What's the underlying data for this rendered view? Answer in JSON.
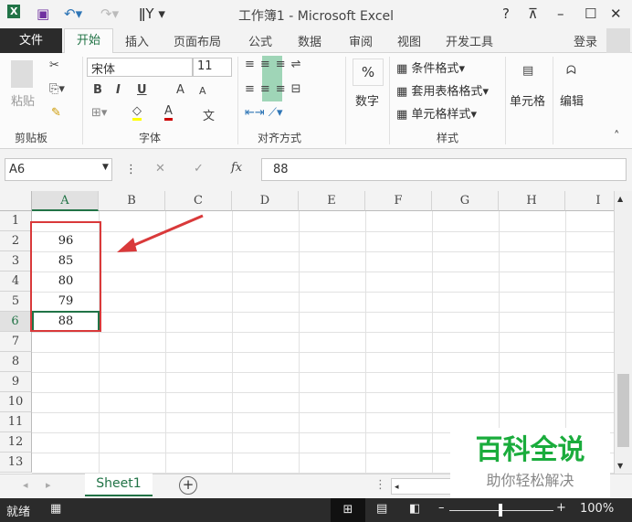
{
  "title": "工作簿1 - Microsoft Excel",
  "window_buttons": {
    "help": "?",
    "restore_ribbon": "⊼",
    "minimize": "–",
    "maximize": "☐",
    "close": "✕"
  },
  "tabs": {
    "file": "文件",
    "home": "开始",
    "insert": "插入",
    "layout": "页面布局",
    "formulas": "公式",
    "data": "数据",
    "review": "审阅",
    "view": "视图",
    "developer": "开发工具",
    "signin": "登录"
  },
  "ribbon": {
    "clipboard": {
      "paste": "粘贴",
      "label": "剪贴板"
    },
    "font": {
      "name": "宋体",
      "size": "11",
      "bold": "B",
      "italic": "I",
      "underline": "U",
      "grow": "A",
      "shrink": "A",
      "color": "A",
      "phonetic": "文",
      "label": "字体"
    },
    "alignment": {
      "label": "对齐方式"
    },
    "number": {
      "percent": "%",
      "label": "数字"
    },
    "styles": {
      "conditional": "条件格式",
      "table": "套用表格格式",
      "cell": "单元格样式",
      "label": "样式"
    },
    "cells": {
      "label": "单元格"
    },
    "editing": {
      "label": "编辑"
    }
  },
  "formula_bar": {
    "name_box": "A6",
    "cancel": "✕",
    "enter": "✓",
    "fx": "fx",
    "value": "88"
  },
  "columns": [
    "A",
    "B",
    "C",
    "D",
    "E",
    "F",
    "G",
    "H",
    "I"
  ],
  "rows": [
    "1",
    "2",
    "3",
    "4",
    "5",
    "6",
    "7",
    "8",
    "9",
    "10",
    "11",
    "12",
    "13"
  ],
  "cells": {
    "A2": "96",
    "A3": "85",
    "A4": "80",
    "A5": "79",
    "A6": "88"
  },
  "active_cell": "A6",
  "sheet_tabs": [
    "Sheet1"
  ],
  "status": {
    "ready": "就绪",
    "zoom": "100%",
    "zoom_level": 1.0
  },
  "watermark": {
    "title": "百科全说",
    "subtitle": "助你轻松解决"
  },
  "colors": {
    "accent": "#217346",
    "annotation": "#d9393a",
    "watermark": "#1aac3c"
  }
}
